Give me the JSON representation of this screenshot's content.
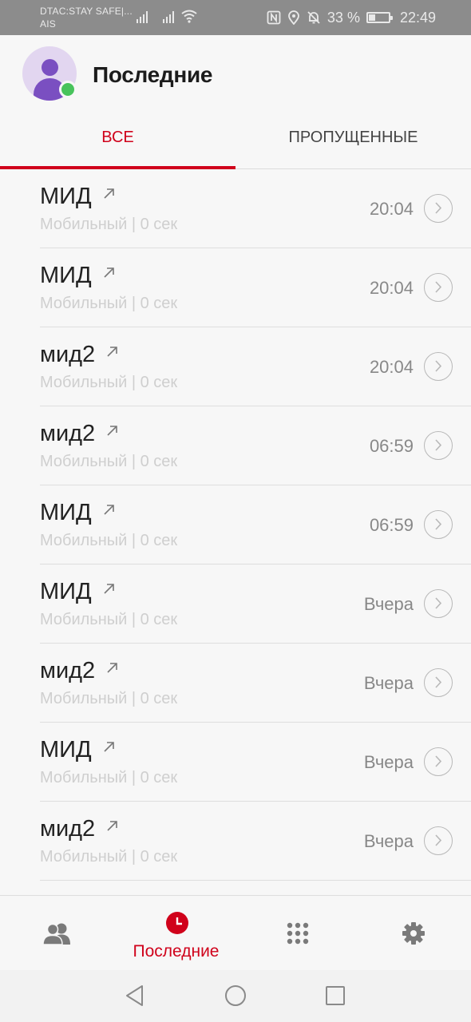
{
  "status_bar": {
    "carrier_1": "DTAC:STAY SAFE|...",
    "carrier_2": "AIS",
    "battery_percent": "33 %",
    "battery_level": 0.33,
    "time": "22:49",
    "icons": [
      "signal-icon",
      "signal-icon",
      "wifi-icon",
      "nfc-icon",
      "location-icon",
      "bell-off-icon",
      "battery-icon"
    ]
  },
  "header": {
    "title": "Последние"
  },
  "tabs": [
    {
      "label": "ВСЕ",
      "active": true
    },
    {
      "label": "ПРОПУЩЕННЫЕ",
      "active": false
    }
  ],
  "calls": [
    {
      "name": "МИД",
      "detail": "Мобильный | 0 сек",
      "time": "20:04"
    },
    {
      "name": "МИД",
      "detail": "Мобильный | 0 сек",
      "time": "20:04"
    },
    {
      "name": "мид2",
      "detail": "Мобильный | 0 сек",
      "time": "20:04"
    },
    {
      "name": "мид2",
      "detail": "Мобильный | 0 сек",
      "time": "06:59"
    },
    {
      "name": "МИД",
      "detail": "Мобильный | 0 сек",
      "time": "06:59"
    },
    {
      "name": "МИД",
      "detail": "Мобильный | 0 сек",
      "time": "Вчера"
    },
    {
      "name": "мид2",
      "detail": "Мобильный | 0 сек",
      "time": "Вчера"
    },
    {
      "name": "МИД",
      "detail": "Мобильный | 0 сек",
      "time": "Вчера"
    },
    {
      "name": "мид2",
      "detail": "Мобильный | 0 сек",
      "time": "Вчера"
    }
  ],
  "bottom_nav": {
    "items": [
      {
        "icon": "contacts-icon",
        "label": ""
      },
      {
        "icon": "clock-icon",
        "label": "Последние",
        "active": true
      },
      {
        "icon": "dialpad-icon",
        "label": ""
      },
      {
        "icon": "gear-icon",
        "label": ""
      }
    ]
  },
  "colors": {
    "accent": "#d0021b",
    "online": "#48c35c",
    "avatar": "#7a4fc1"
  }
}
